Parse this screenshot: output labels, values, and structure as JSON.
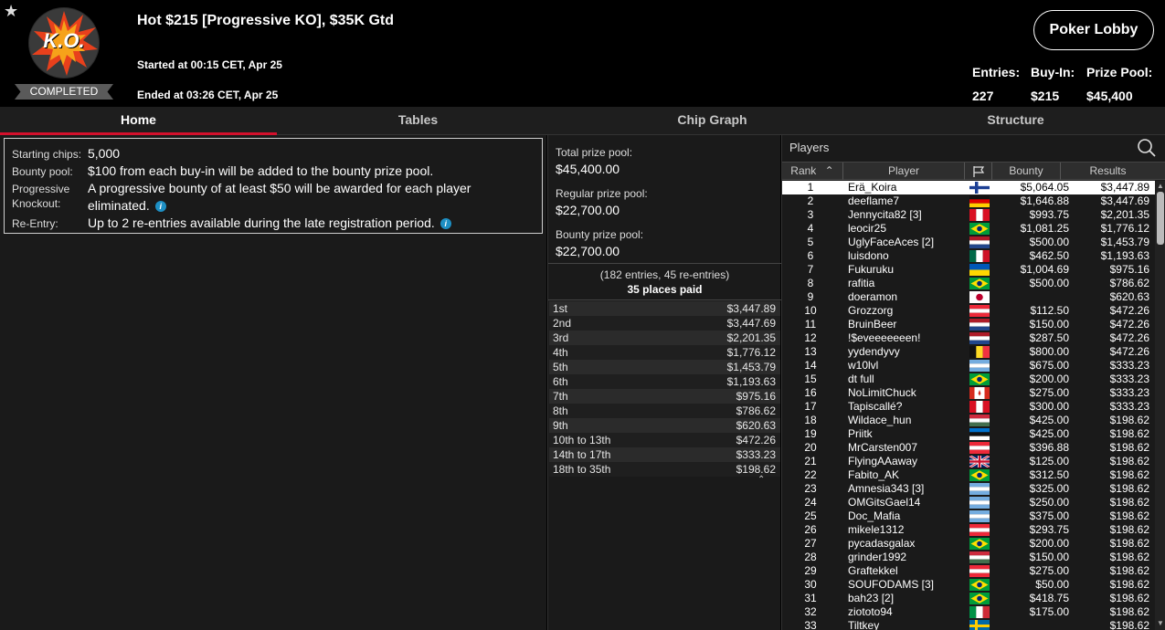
{
  "header": {
    "star": "★",
    "logo_text": "K.O.",
    "status": "COMPLETED",
    "title": "Hot $215 [Progressive KO], $35K Gtd",
    "started": "Started at 00:15 CET, Apr 25",
    "ended": "Ended at 03:26 CET, Apr 25",
    "lobby_button": "Poker Lobby",
    "entries_label": "Entries:",
    "entries_value": "227",
    "buyin_label": "Buy-In:",
    "buyin_value": "$215",
    "prizepool_label": "Prize Pool:",
    "prizepool_value": "$45,400"
  },
  "tabs": [
    {
      "label": "Home",
      "active": true
    },
    {
      "label": "Tables",
      "active": false
    },
    {
      "label": "Chip Graph",
      "active": false
    },
    {
      "label": "Structure",
      "active": false
    }
  ],
  "home": {
    "starting_chips_label": "Starting chips:",
    "starting_chips_value": "5,000",
    "bounty_pool_label": "Bounty pool:",
    "bounty_pool_value": "$100 from each buy-in will be added to the bounty prize pool.",
    "progressive_label_1": "Progressive",
    "progressive_label_2": "Knockout:",
    "progressive_value_1": "A progressive bounty of at least $50 will be awarded for each player",
    "progressive_value_2": "eliminated.",
    "reentry_label": "Re-Entry:",
    "reentry_value": "Up to 2 re-entries available during the late registration period."
  },
  "prize": {
    "total_label": "Total prize pool:",
    "total_value": "$45,400.00",
    "regular_label": "Regular prize pool:",
    "regular_value": "$22,700.00",
    "bounty_label": "Bounty prize pool:",
    "bounty_value": "$22,700.00",
    "entries_note": "(182 entries, 45 re-entries)",
    "places_paid": "35 places paid",
    "payouts": [
      {
        "place": "1st",
        "amount": "$3,447.89"
      },
      {
        "place": "2nd",
        "amount": "$3,447.69"
      },
      {
        "place": "3rd",
        "amount": "$2,201.35"
      },
      {
        "place": "4th",
        "amount": "$1,776.12"
      },
      {
        "place": "5th",
        "amount": "$1,453.79"
      },
      {
        "place": "6th",
        "amount": "$1,193.63"
      },
      {
        "place": "7th",
        "amount": "$975.16"
      },
      {
        "place": "8th",
        "amount": "$786.62"
      },
      {
        "place": "9th",
        "amount": "$620.63"
      },
      {
        "place": "10th to 13th",
        "amount": "$472.26"
      },
      {
        "place": "14th to 17th",
        "amount": "$333.23"
      },
      {
        "place": "18th to 35th",
        "amount": "$198.62"
      }
    ]
  },
  "players": {
    "title": "Players",
    "columns": [
      "Rank",
      "Player",
      "",
      "Bounty",
      "Results"
    ],
    "rows": [
      {
        "rank": "1",
        "name": "Erä_Koira",
        "flag": "fi",
        "bounty": "$5,064.05",
        "result": "$3,447.89",
        "selected": true
      },
      {
        "rank": "2",
        "name": "deeflame7",
        "flag": "de",
        "bounty": "$1,646.88",
        "result": "$3,447.69"
      },
      {
        "rank": "3",
        "name": "Jennycita82 [3]",
        "flag": "pe",
        "bounty": "$993.75",
        "result": "$2,201.35"
      },
      {
        "rank": "4",
        "name": "leocir25",
        "flag": "br",
        "bounty": "$1,081.25",
        "result": "$1,776.12"
      },
      {
        "rank": "5",
        "name": "UglyFaceAces [2]",
        "flag": "nl",
        "bounty": "$500.00",
        "result": "$1,453.79"
      },
      {
        "rank": "6",
        "name": "luisdono",
        "flag": "mx",
        "bounty": "$462.50",
        "result": "$1,193.63"
      },
      {
        "rank": "7",
        "name": "Fukuruku",
        "flag": "ua",
        "bounty": "$1,004.69",
        "result": "$975.16"
      },
      {
        "rank": "8",
        "name": "rafitia",
        "flag": "br",
        "bounty": "$500.00",
        "result": "$786.62"
      },
      {
        "rank": "9",
        "name": "doeramon",
        "flag": "jp",
        "bounty": "",
        "result": "$620.63"
      },
      {
        "rank": "10",
        "name": "Grozzorg",
        "flag": "at",
        "bounty": "$112.50",
        "result": "$472.26"
      },
      {
        "rank": "11",
        "name": "BruinBeer",
        "flag": "nl",
        "bounty": "$150.00",
        "result": "$472.26"
      },
      {
        "rank": "12",
        "name": "!$eveeeeeeen!",
        "flag": "nl",
        "bounty": "$287.50",
        "result": "$472.26"
      },
      {
        "rank": "13",
        "name": "yydendyvy",
        "flag": "be",
        "bounty": "$800.00",
        "result": "$472.26"
      },
      {
        "rank": "14",
        "name": "w10lvl",
        "flag": "ar",
        "bounty": "$675.00",
        "result": "$333.23"
      },
      {
        "rank": "15",
        "name": "dt full",
        "flag": "br",
        "bounty": "$200.00",
        "result": "$333.23"
      },
      {
        "rank": "16",
        "name": "NoLimitChuck",
        "flag": "ca",
        "bounty": "$275.00",
        "result": "$333.23"
      },
      {
        "rank": "17",
        "name": "Tapiscallé?",
        "flag": "pe",
        "bounty": "$300.00",
        "result": "$333.23"
      },
      {
        "rank": "18",
        "name": "Wildace_hun",
        "flag": "hu",
        "bounty": "$425.00",
        "result": "$198.62"
      },
      {
        "rank": "19",
        "name": "Priitk",
        "flag": "ee",
        "bounty": "$425.00",
        "result": "$198.62"
      },
      {
        "rank": "20",
        "name": "MrCarsten007",
        "flag": "at",
        "bounty": "$396.88",
        "result": "$198.62"
      },
      {
        "rank": "21",
        "name": "FlyingAAaway",
        "flag": "gb",
        "bounty": "$125.00",
        "result": "$198.62"
      },
      {
        "rank": "22",
        "name": "Fabito_AK",
        "flag": "br",
        "bounty": "$312.50",
        "result": "$198.62"
      },
      {
        "rank": "23",
        "name": "Amnesia343 [3]",
        "flag": "ar",
        "bounty": "$325.00",
        "result": "$198.62"
      },
      {
        "rank": "24",
        "name": "OMGitsGael14",
        "flag": "ar",
        "bounty": "$250.00",
        "result": "$198.62"
      },
      {
        "rank": "25",
        "name": "Doc_Mafia",
        "flag": "ar",
        "bounty": "$375.00",
        "result": "$198.62"
      },
      {
        "rank": "26",
        "name": "mikele1312",
        "flag": "at",
        "bounty": "$293.75",
        "result": "$198.62"
      },
      {
        "rank": "27",
        "name": "pycadasgalax",
        "flag": "br",
        "bounty": "$200.00",
        "result": "$198.62"
      },
      {
        "rank": "28",
        "name": "grinder1992",
        "flag": "hu",
        "bounty": "$150.00",
        "result": "$198.62"
      },
      {
        "rank": "29",
        "name": "Graftekkel",
        "flag": "at",
        "bounty": "$275.00",
        "result": "$198.62"
      },
      {
        "rank": "30",
        "name": "SOUFODAMS [3]",
        "flag": "br",
        "bounty": "$50.00",
        "result": "$198.62"
      },
      {
        "rank": "31",
        "name": "bah23 [2]",
        "flag": "br",
        "bounty": "$418.75",
        "result": "$198.62"
      },
      {
        "rank": "32",
        "name": "ziototo94",
        "flag": "it",
        "bounty": "$175.00",
        "result": "$198.62"
      },
      {
        "rank": "33",
        "name": "Tiltkey",
        "flag": "se",
        "bounty": "",
        "result": "$198.62"
      }
    ]
  },
  "colors": {
    "accent_red": "#d4102c",
    "selected_row": "#ffffff",
    "info_icon": "#1d8fc4"
  }
}
